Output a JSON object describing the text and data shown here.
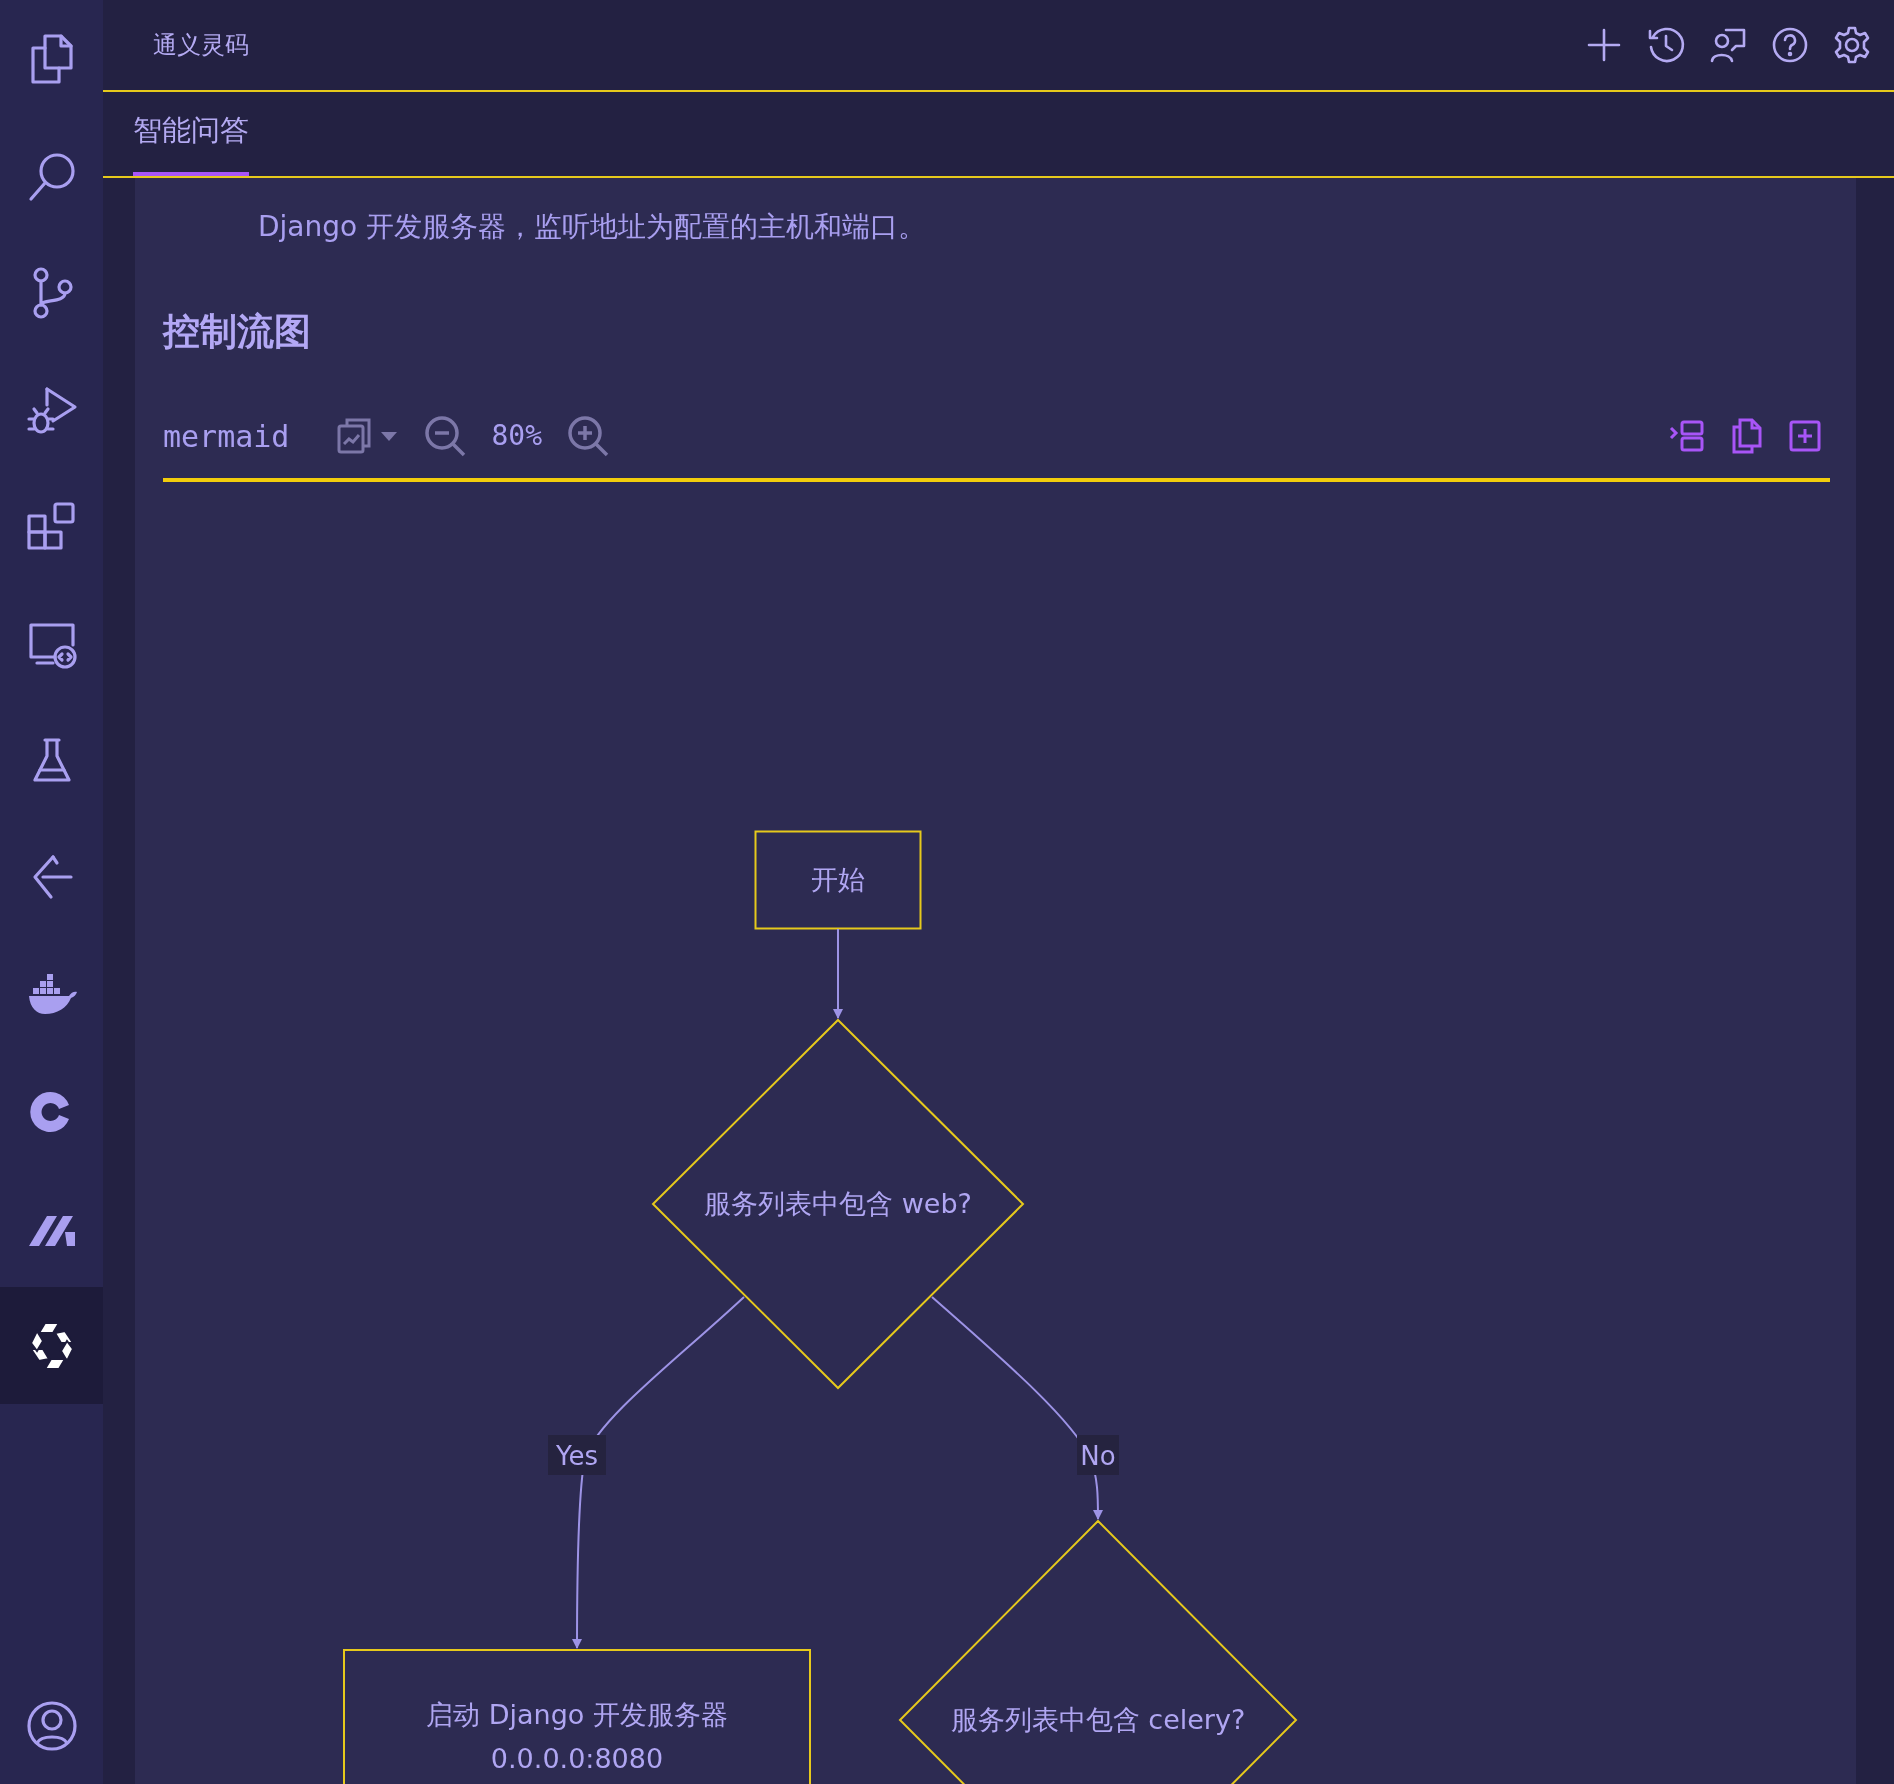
{
  "activity_bar": {
    "items": [
      {
        "selected": false
      },
      {
        "selected": false
      },
      {
        "selected": false
      },
      {
        "selected": false
      },
      {
        "selected": false
      },
      {
        "selected": false
      },
      {
        "selected": false
      },
      {
        "selected": false
      },
      {
        "selected": false
      },
      {
        "selected": false
      },
      {
        "selected": false
      },
      {
        "selected": true
      }
    ]
  },
  "header": {
    "title": "通义灵码"
  },
  "tabs": [
    {
      "label": "智能问答",
      "selected": true
    }
  ],
  "content": {
    "paragraph": "Django 开发服务器，监听地址为配置的主机和端口。",
    "heading": "控制流图",
    "code_block": {
      "language": "mermaid",
      "zoom": "80%",
      "flowchart": {
        "nodes": [
          {
            "kind": "box",
            "lines": [
              "开始"
            ]
          },
          {
            "kind": "diamond",
            "lines": [
              "服务列表中包含 web?"
            ]
          },
          {
            "kind": "box",
            "lines": [
              "启动 Django 开发服务器",
              "0.0.0.0:8080"
            ]
          },
          {
            "kind": "diamond",
            "lines": [
              "服务列表中包含 celery?"
            ]
          }
        ],
        "edges": [
          {
            "kind": "plain"
          },
          {
            "kind": "labeled",
            "label": "Yes"
          },
          {
            "kind": "labeled",
            "label": "No"
          }
        ]
      }
    }
  }
}
